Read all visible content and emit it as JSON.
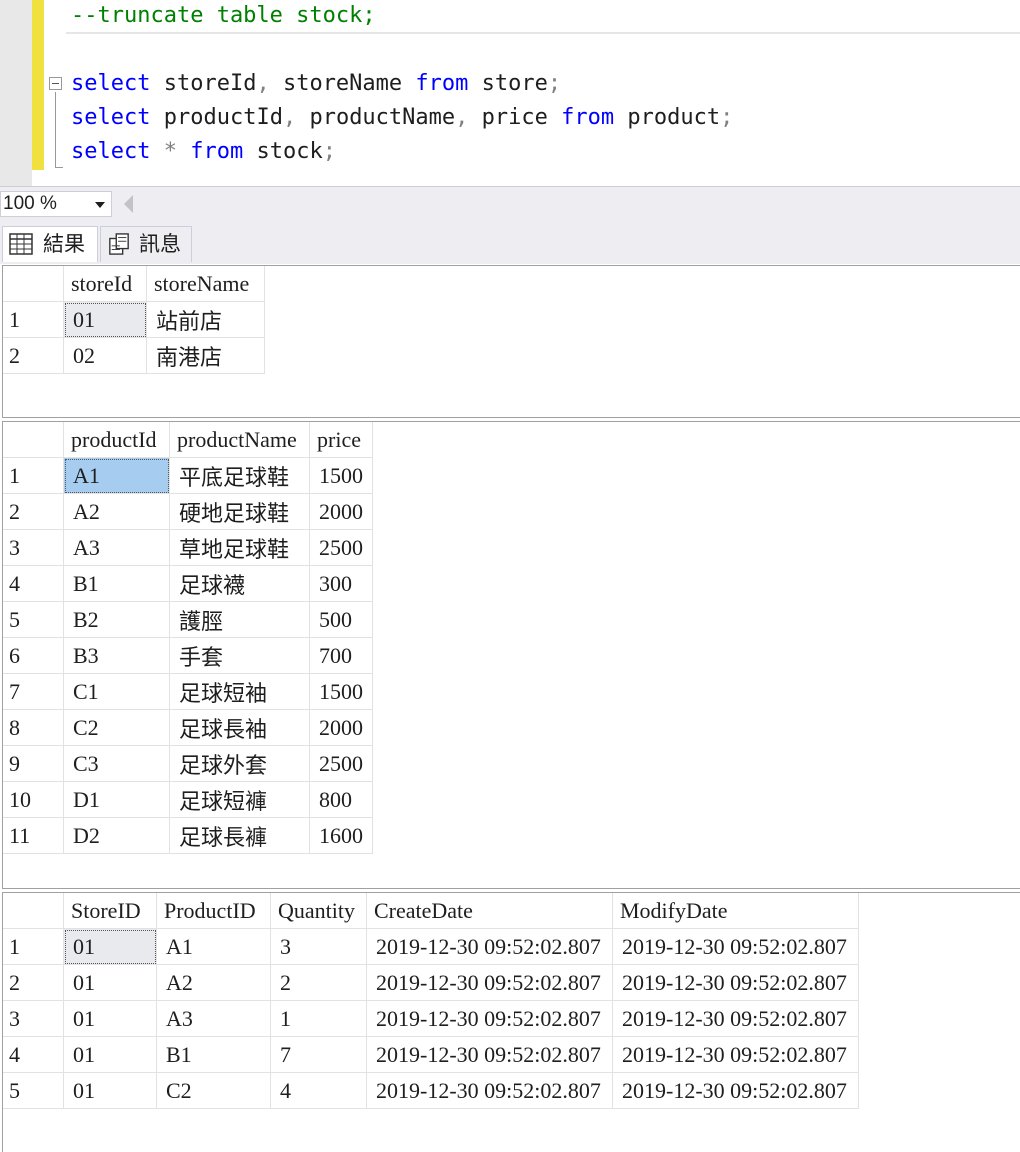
{
  "editor": {
    "line1": "--truncate table stock;",
    "query1": {
      "kw1": "select",
      "col1": "storeId",
      "sep1": ",",
      "col2": "storeName",
      "kw2": "from",
      "tbl": "store",
      "end": ";"
    },
    "query2": {
      "kw1": "select",
      "col1": "productId",
      "sep1": ",",
      "col2": "productName",
      "sep2": ",",
      "col3": "price",
      "kw2": "from",
      "tbl": "product",
      "end": ";"
    },
    "query3": {
      "kw1": "select",
      "star": "*",
      "kw2": "from",
      "tbl": "stock",
      "end": ";"
    }
  },
  "zoom": {
    "value": "100 %"
  },
  "tabs": [
    {
      "label": "結果",
      "icon": "grid-icon",
      "active": true
    },
    {
      "label": "訊息",
      "icon": "messages-icon",
      "active": false
    }
  ],
  "results": [
    {
      "columns": [
        "storeId",
        "storeName"
      ],
      "rows": [
        [
          "1",
          "01",
          "站前店"
        ],
        [
          "2",
          "02",
          "南港店"
        ]
      ]
    },
    {
      "columns": [
        "productId",
        "productName",
        "price"
      ],
      "rows": [
        [
          "1",
          "A1",
          "平底足球鞋",
          "1500"
        ],
        [
          "2",
          "A2",
          "硬地足球鞋",
          "2000"
        ],
        [
          "3",
          "A3",
          "草地足球鞋",
          "2500"
        ],
        [
          "4",
          "B1",
          "足球襪",
          "300"
        ],
        [
          "5",
          "B2",
          "護脛",
          "500"
        ],
        [
          "6",
          "B3",
          "手套",
          "700"
        ],
        [
          "7",
          "C1",
          "足球短袖",
          "1500"
        ],
        [
          "8",
          "C2",
          "足球長袖",
          "2000"
        ],
        [
          "9",
          "C3",
          "足球外套",
          "2500"
        ],
        [
          "10",
          "D1",
          "足球短褲",
          "800"
        ],
        [
          "11",
          "D2",
          "足球長褲",
          "1600"
        ]
      ]
    },
    {
      "columns": [
        "StoreID",
        "ProductID",
        "Quantity",
        "CreateDate",
        "ModifyDate"
      ],
      "rows": [
        [
          "1",
          "01",
          "A1",
          "3",
          "2019-12-30 09:52:02.807",
          "2019-12-30 09:52:02.807"
        ],
        [
          "2",
          "01",
          "A2",
          "2",
          "2019-12-30 09:52:02.807",
          "2019-12-30 09:52:02.807"
        ],
        [
          "3",
          "01",
          "A3",
          "1",
          "2019-12-30 09:52:02.807",
          "2019-12-30 09:52:02.807"
        ],
        [
          "4",
          "01",
          "B1",
          "7",
          "2019-12-30 09:52:02.807",
          "2019-12-30 09:52:02.807"
        ],
        [
          "5",
          "01",
          "C2",
          "4",
          "2019-12-30 09:52:02.807",
          "2019-12-30 09:52:02.807"
        ]
      ]
    }
  ],
  "colors": {
    "keyword": "#0000ff",
    "comment": "#008000",
    "selection": "#a6cdf0",
    "change_bar": "#f0e040"
  }
}
